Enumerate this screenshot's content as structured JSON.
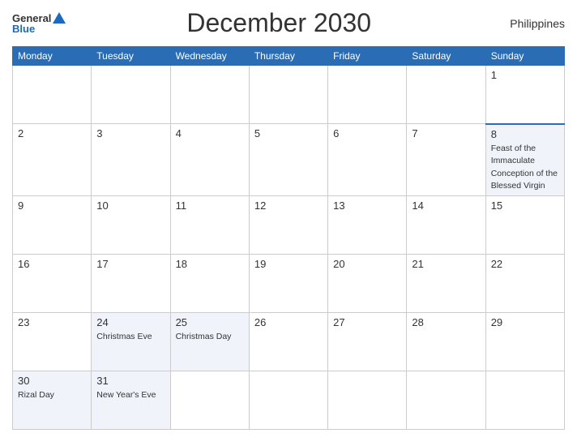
{
  "header": {
    "logo_general": "General",
    "logo_blue": "Blue",
    "title": "December 2030",
    "country": "Philippines"
  },
  "days_of_week": [
    "Monday",
    "Tuesday",
    "Wednesday",
    "Thursday",
    "Friday",
    "Saturday",
    "Sunday"
  ],
  "weeks": [
    [
      {
        "date": "",
        "holiday": ""
      },
      {
        "date": "",
        "holiday": ""
      },
      {
        "date": "",
        "holiday": ""
      },
      {
        "date": "",
        "holiday": ""
      },
      {
        "date": "",
        "holiday": ""
      },
      {
        "date": "",
        "holiday": ""
      },
      {
        "date": "1",
        "holiday": ""
      }
    ],
    [
      {
        "date": "2",
        "holiday": ""
      },
      {
        "date": "3",
        "holiday": ""
      },
      {
        "date": "4",
        "holiday": ""
      },
      {
        "date": "5",
        "holiday": ""
      },
      {
        "date": "6",
        "holiday": ""
      },
      {
        "date": "7",
        "holiday": ""
      },
      {
        "date": "8",
        "holiday": "Feast of the Immaculate Conception of the Blessed Virgin"
      }
    ],
    [
      {
        "date": "9",
        "holiday": ""
      },
      {
        "date": "10",
        "holiday": ""
      },
      {
        "date": "11",
        "holiday": ""
      },
      {
        "date": "12",
        "holiday": ""
      },
      {
        "date": "13",
        "holiday": ""
      },
      {
        "date": "14",
        "holiday": ""
      },
      {
        "date": "15",
        "holiday": ""
      }
    ],
    [
      {
        "date": "16",
        "holiday": ""
      },
      {
        "date": "17",
        "holiday": ""
      },
      {
        "date": "18",
        "holiday": ""
      },
      {
        "date": "19",
        "holiday": ""
      },
      {
        "date": "20",
        "holiday": ""
      },
      {
        "date": "21",
        "holiday": ""
      },
      {
        "date": "22",
        "holiday": ""
      }
    ],
    [
      {
        "date": "23",
        "holiday": ""
      },
      {
        "date": "24",
        "holiday": "Christmas Eve"
      },
      {
        "date": "25",
        "holiday": "Christmas Day"
      },
      {
        "date": "26",
        "holiday": ""
      },
      {
        "date": "27",
        "holiday": ""
      },
      {
        "date": "28",
        "holiday": ""
      },
      {
        "date": "29",
        "holiday": ""
      }
    ],
    [
      {
        "date": "30",
        "holiday": "Rizal Day"
      },
      {
        "date": "31",
        "holiday": "New Year's Eve"
      },
      {
        "date": "",
        "holiday": ""
      },
      {
        "date": "",
        "holiday": ""
      },
      {
        "date": "",
        "holiday": ""
      },
      {
        "date": "",
        "holiday": ""
      },
      {
        "date": "",
        "holiday": ""
      }
    ]
  ]
}
